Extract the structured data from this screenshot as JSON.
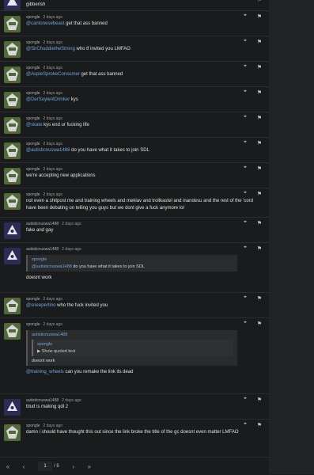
{
  "top_fragment": {
    "text": "gibberish"
  },
  "posts": [
    {
      "author": "spongle",
      "time": "2 days ago",
      "mention": "@cantonesebeast",
      "text": " get that ass banned"
    },
    {
      "author": "spongle",
      "time": "2 days ago",
      "mention": "@SirChuddietheStrong",
      "text": " who tf invited you LMFAO"
    },
    {
      "author": "spongle",
      "time": "2 days ago",
      "mention": "@AspieSprokeConsumer",
      "text": " get that ass banned"
    },
    {
      "author": "spongle",
      "time": "2 days ago",
      "mention": "@DerSoylentDrinker",
      "text": " kys"
    },
    {
      "author": "spongle",
      "time": "2 days ago",
      "mention": "@skate",
      "text": " kys end ur fucking life"
    },
    {
      "author": "spongle",
      "time": "2 days ago",
      "mention": "@autisticnuswa1488",
      "text": " do you have what it takes to join SDL"
    },
    {
      "author": "spongle",
      "time": "2 days ago",
      "text": "we're accepting new applications"
    },
    {
      "author": "spongle",
      "time": "2 days ago",
      "text": "not even a shitpost me and training wheels and meklav and trollkastel and inandesu and the rest of the 'cord have been debating on telling you guys but we dont give a fuck anymore lol"
    },
    {
      "author": "autisticnuswa1488",
      "time": "2 days ago",
      "text": "fake and gay"
    },
    {
      "author": "autisticnuswa1488",
      "time": "2 days ago",
      "quote_author": "spongle",
      "quote_mention": "@autisticnuswa1488",
      "quote_text": " do you have what it takes to join SDL",
      "text": "doesnt work"
    },
    {
      "author": "spongle",
      "time": "2 days ago",
      "mention": "@sneepertino",
      "text": " who the fuck invited you"
    },
    {
      "author": "spongle",
      "time": "2 days ago",
      "quote_author": "autisticnuswa1488",
      "inner_author": "spongle",
      "inner_toggle": "▶ Show quoted text",
      "quote_text": "doesnt work",
      "mention": "@training_wheels",
      "text": " can you remake the link its dead"
    },
    {
      "author": "autisticnuswa1488",
      "time": "2 days ago",
      "text": "blud is making qdl 2"
    },
    {
      "author": "spongle",
      "time": "2 days ago",
      "text": "damn i should have thought this out since the link broke the title of the gc doesnt even matter LMFAO"
    }
  ],
  "pagination": {
    "first": "«",
    "prev": "‹",
    "current": "1",
    "total": "/ 6",
    "next": "›",
    "last": "»"
  },
  "colors": {
    "mention": "#6fa6dd",
    "background": "#1a1b1c"
  },
  "icons": {
    "quote": "quote-icon",
    "report": "flag-icon"
  }
}
